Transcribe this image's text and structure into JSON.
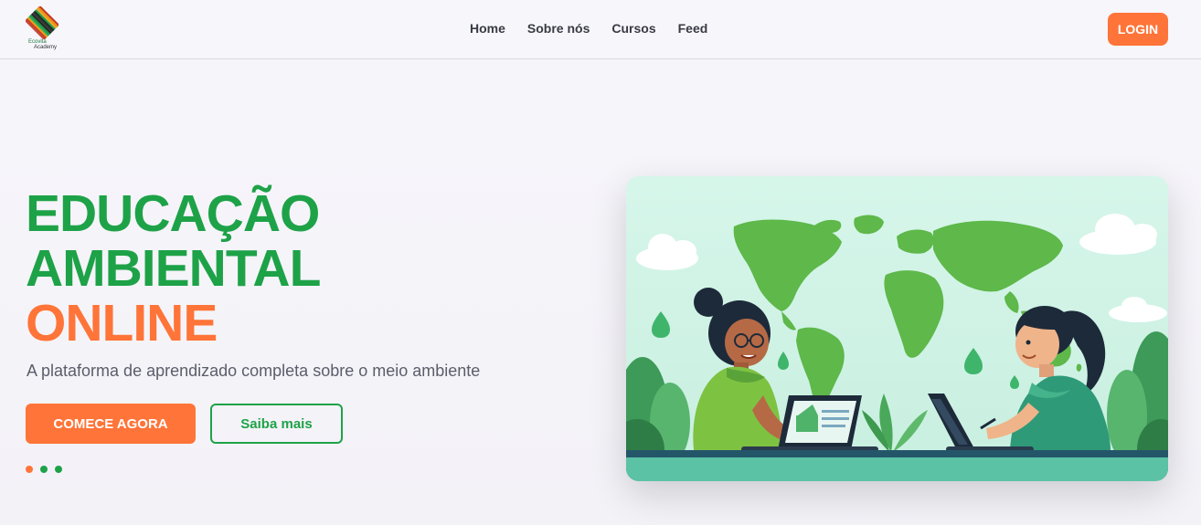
{
  "brand": {
    "name": "Ecovita",
    "subname": "Academy"
  },
  "nav": {
    "items": [
      "Home",
      "Sobre nós",
      "Cursos",
      "Feed"
    ]
  },
  "header": {
    "login_label": "LOGIN"
  },
  "hero": {
    "title_line1": "EDUCAÇÃO",
    "title_line2": "AMBIENTAL",
    "title_line3": "ONLINE",
    "subtitle": "A plataforma de aprendizado completa sobre o meio ambiente",
    "primary_cta": "COMECE AGORA",
    "secondary_cta": "Saiba mais"
  },
  "carousel": {
    "slides": 3,
    "active_index": 0
  },
  "colors": {
    "brand_green": "#1ea248",
    "brand_orange": "#ff7438",
    "text_dark": "#3a3a45",
    "text_muted": "#5b5d6b"
  },
  "icons": {
    "logo": "ecovita-logo-icon"
  }
}
